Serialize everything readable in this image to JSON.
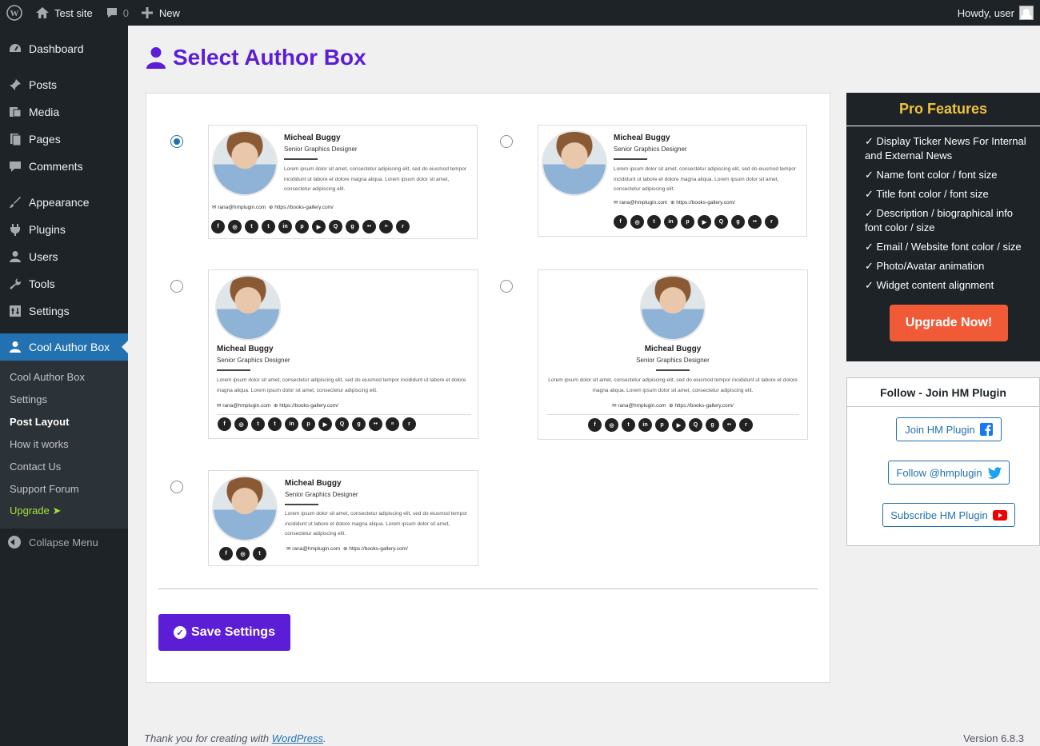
{
  "adminbar": {
    "site_name": "Test site",
    "comments_count": "0",
    "new_label": "New",
    "howdy": "Howdy, user"
  },
  "sidebar": {
    "items": [
      {
        "label": "Dashboard",
        "icon": "dashboard-icon"
      },
      {
        "label": "Posts",
        "icon": "pin-icon"
      },
      {
        "label": "Media",
        "icon": "media-icon"
      },
      {
        "label": "Pages",
        "icon": "pages-icon"
      },
      {
        "label": "Comments",
        "icon": "comment-icon"
      },
      {
        "label": "Appearance",
        "icon": "brush-icon"
      },
      {
        "label": "Plugins",
        "icon": "plug-icon"
      },
      {
        "label": "Users",
        "icon": "user-icon"
      },
      {
        "label": "Tools",
        "icon": "wrench-icon"
      },
      {
        "label": "Settings",
        "icon": "settings-icon"
      },
      {
        "label": "Cool Author Box",
        "icon": "user-icon"
      }
    ],
    "submenu": [
      {
        "label": "Cool Author Box"
      },
      {
        "label": "Settings"
      },
      {
        "label": "Post Layout"
      },
      {
        "label": "How it works"
      },
      {
        "label": "Contact Us"
      },
      {
        "label": "Support Forum"
      },
      {
        "label": "Upgrade ➤"
      }
    ],
    "collapse_label": "Collapse Menu"
  },
  "page": {
    "title": "Select Author Box",
    "save_label": "Save Settings"
  },
  "author_card": {
    "name": "Micheal Buggy",
    "role": "Senior Graphics Designer",
    "desc_short": "Lorem ipsum dolor sit amet, consectetur adipiscing elit, sed do eiusmod tempor incididunt ut labore et dolore magna aliqua. Lorem ipsum dolor sit amet, consectetur adipiscing elit.",
    "email": "✉ rana@hmplugin.com",
    "website": "⊕ https://books-gallery.com/"
  },
  "layouts": {
    "selected_index": 0
  },
  "pro": {
    "title": "Pro Features",
    "features": [
      "✓ Display Ticker News For Internal and External News",
      "✓ Name font color / font size",
      "✓ Title font color / font size",
      "✓ Description / biographical info font color / size",
      "✓ Email / Website font color / size",
      "✓ Photo/Avatar animation",
      "✓ Widget content alignment"
    ],
    "upgrade_label": "Upgrade Now!"
  },
  "follow": {
    "title": "Follow - Join HM Plugin",
    "join_label": "Join HM Plugin",
    "twitter_label": "Follow @hmplugin",
    "youtube_label": "Subscribe HM Plugin"
  },
  "footer": {
    "thanks_prefix": "Thank you for creating with ",
    "wp_link": "WordPress",
    "thanks_suffix": ".",
    "version": "Version 6.8.3"
  }
}
